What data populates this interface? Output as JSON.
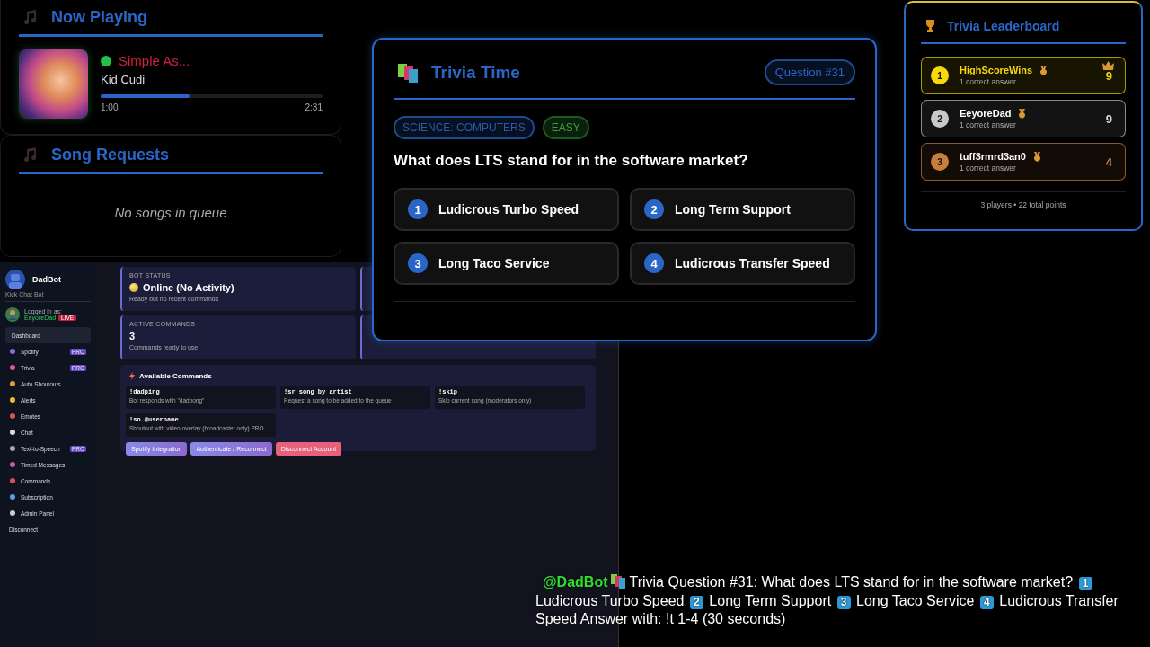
{
  "now_playing": {
    "title": "Now Playing",
    "playing": true,
    "track": "Simple As...",
    "artist": "Kid Cudi",
    "level": 0.4,
    "elapsed": "1:00",
    "duration": "2:31"
  },
  "song_requests": {
    "title": "Song Requests",
    "empty_text": "No songs in queue"
  },
  "dashboard": {
    "bot_name": "DadBot",
    "subtitle": "Kick Chat Bot",
    "logged_in_label": "Logged in as:",
    "user": "EeyoreDad",
    "live_badge": "LIVE",
    "nav": [
      {
        "label": "Dashboard",
        "selected": true
      },
      {
        "label": "Spotify",
        "badge": "PRO",
        "selected": false
      },
      {
        "label": "Trivia",
        "badge": "PRO",
        "selected": false
      },
      {
        "label": "Auto Shoutouts",
        "selected": false
      },
      {
        "label": "Alerts",
        "selected": false
      },
      {
        "label": "Emotes",
        "selected": false
      },
      {
        "label": "Chat",
        "selected": false
      },
      {
        "label": "Text-to-Speech",
        "badge": "PRO",
        "selected": false
      },
      {
        "label": "Timed Messages",
        "selected": false
      },
      {
        "label": "Commands",
        "selected": false
      },
      {
        "label": "Subscription",
        "selected": false
      },
      {
        "label": "Admin Panel",
        "selected": false
      }
    ],
    "disconnect": "Disconnect",
    "stats": [
      {
        "label": "BOT STATUS",
        "value": "Online (No Activity)",
        "note": "Ready but no recent commands",
        "status": true
      },
      {
        "label": "ACTIVE COMMANDS",
        "value": "3",
        "note": "Commands ready to use",
        "status": false
      }
    ],
    "commands_title": "Available Commands",
    "commands": [
      {
        "command": "!dadping",
        "description": "Bot responds with \"dadpong\""
      },
      {
        "command": "!sr song by artist",
        "description": "Request a song to be added to the queue"
      },
      {
        "command": "!skip",
        "description": "Skip current song (moderators only)"
      },
      {
        "command": "!so @username",
        "description": "Shoutout with video overlay (broadcaster only) PRO"
      }
    ],
    "buttons": [
      {
        "label": "Spotify Integration",
        "kind": "primary"
      },
      {
        "label": "Authenticate / Reconnect",
        "kind": "primary"
      },
      {
        "label": "Disconnect Account",
        "kind": "danger"
      }
    ]
  },
  "trivia": {
    "title": "Trivia Time",
    "question_badge": "Question #31",
    "category": "SCIENCE: COMPUTERS",
    "difficulty": "EASY",
    "question": "What does LTS stand for in the software market?",
    "answers": [
      {
        "number": "1",
        "text": "Ludicrous Turbo Speed"
      },
      {
        "number": "2",
        "text": "Long Term Support"
      },
      {
        "number": "3",
        "text": "Long Taco Service"
      },
      {
        "number": "4",
        "text": "Ludicrous Transfer Speed"
      }
    ]
  },
  "leaderboard": {
    "title": "Trivia Leaderboard",
    "players": [
      {
        "rank": "1",
        "name": "HighScoreWins",
        "note": "1 correct answer",
        "score": "9",
        "color": "#f5d90a",
        "leader": true
      },
      {
        "rank": "2",
        "name": "EeyoreDad",
        "note": "1 correct answer",
        "score": "9",
        "color": "#c8c8c8",
        "leader": false
      },
      {
        "rank": "3",
        "name": "tuff3rmrd3an0",
        "note": "1 correct answer",
        "score": "4",
        "color": "#c97f3c",
        "leader": false
      }
    ],
    "footer": "3 players • 22 total points"
  },
  "chat": {
    "user": "@DadBot",
    "message_parts": [
      {
        "kind": "text",
        "text": "Trivia Question #31: What does LTS stand for in the software market?"
      },
      {
        "kind": "keycap",
        "text": "1"
      },
      {
        "kind": "text",
        "text": "Ludicrous Turbo Speed"
      },
      {
        "kind": "keycap",
        "text": "2"
      },
      {
        "kind": "text",
        "text": "Long Term Support"
      },
      {
        "kind": "keycap",
        "text": "3"
      },
      {
        "kind": "text",
        "text": "Long Taco Service"
      },
      {
        "kind": "keycap",
        "text": "4"
      },
      {
        "kind": "text",
        "text": "Ludicrous Transfer Speed Answer with: !t 1-4 (30 seconds)"
      }
    ]
  }
}
